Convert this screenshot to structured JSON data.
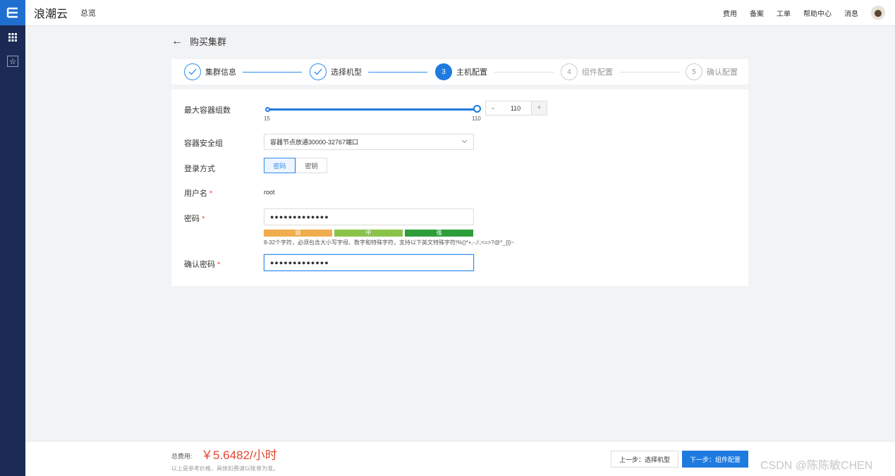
{
  "brand": "浪潮云",
  "overview": "总览",
  "topnav": [
    "费用",
    "备案",
    "工单",
    "帮助中心",
    "消息"
  ],
  "page_title": "购买集群",
  "steps": [
    {
      "index": "",
      "label": "集群信息",
      "state": "done"
    },
    {
      "index": "",
      "label": "选择机型",
      "state": "done"
    },
    {
      "index": "3",
      "label": "主机配置",
      "state": "active"
    },
    {
      "index": "4",
      "label": "组件配置",
      "state": "todo"
    },
    {
      "index": "5",
      "label": "确认配置",
      "state": "todo"
    }
  ],
  "form": {
    "max_containers_label": "最大容器组数",
    "slider_min": "15",
    "slider_max": "110",
    "slider_value": "110",
    "minus": "-",
    "plus": "+",
    "security_group_label": "容器安全组",
    "security_group_value": "容器节点放通30000-32767端口",
    "login_label": "登录方式",
    "login_options": [
      "密码",
      "密钥"
    ],
    "username_label": "用户名",
    "username_value": "root",
    "password_label": "密码",
    "password_value": "●●●●●●●●●●●●●",
    "strength": [
      "弱",
      "中",
      "强"
    ],
    "hint": "8-32个字符，必须包含大小写字母、数字和特殊字符，支持以下英文特殊字符!%()*+,-./:;<=>?@^_{|}~",
    "confirm_label": "确认密码",
    "confirm_value": "●●●●●●●●●●●●●",
    "required_mark": "*"
  },
  "footer": {
    "cost_label": "总费用:",
    "cost_value": "￥5.6482/小时",
    "cost_note": "以上是参考价格，具体扣费请以账单为准。",
    "prev_button": "上一步：选择机型",
    "next_button": "下一步：组件配置",
    "watermark": "CSDN @陈陈敏CHEN"
  },
  "colors": {
    "primary": "#1f7ae0",
    "weak": "#f0ad4e",
    "medium": "#8bc34a",
    "strong": "#2e9e3a",
    "price": "#e6442e",
    "rail": "#1b2a55"
  }
}
